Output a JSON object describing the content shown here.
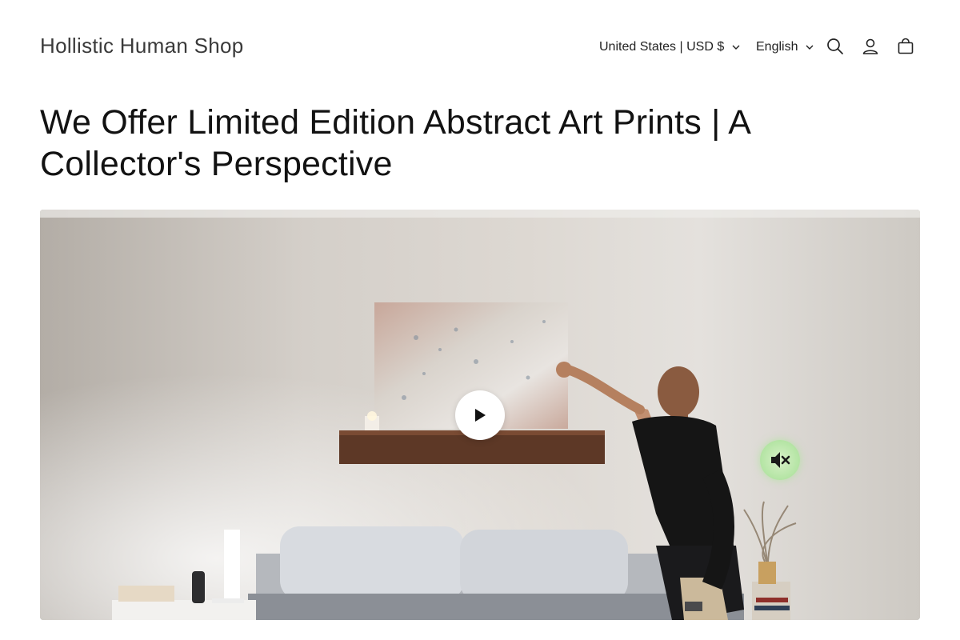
{
  "header": {
    "logo_text": "Hollistic Human Shop",
    "country_selector": "United States | USD $",
    "language_selector": "English",
    "icons": [
      "search-icon",
      "account-icon",
      "cart-icon"
    ]
  },
  "main": {
    "title": "We Offer Limited Edition Abstract Art Prints | A Collector's Perspective"
  },
  "video": {
    "controls": [
      "play-icon",
      "mute-icon"
    ],
    "mute_button_color": "#b8e6a8",
    "play_button_color": "#ffffff"
  }
}
